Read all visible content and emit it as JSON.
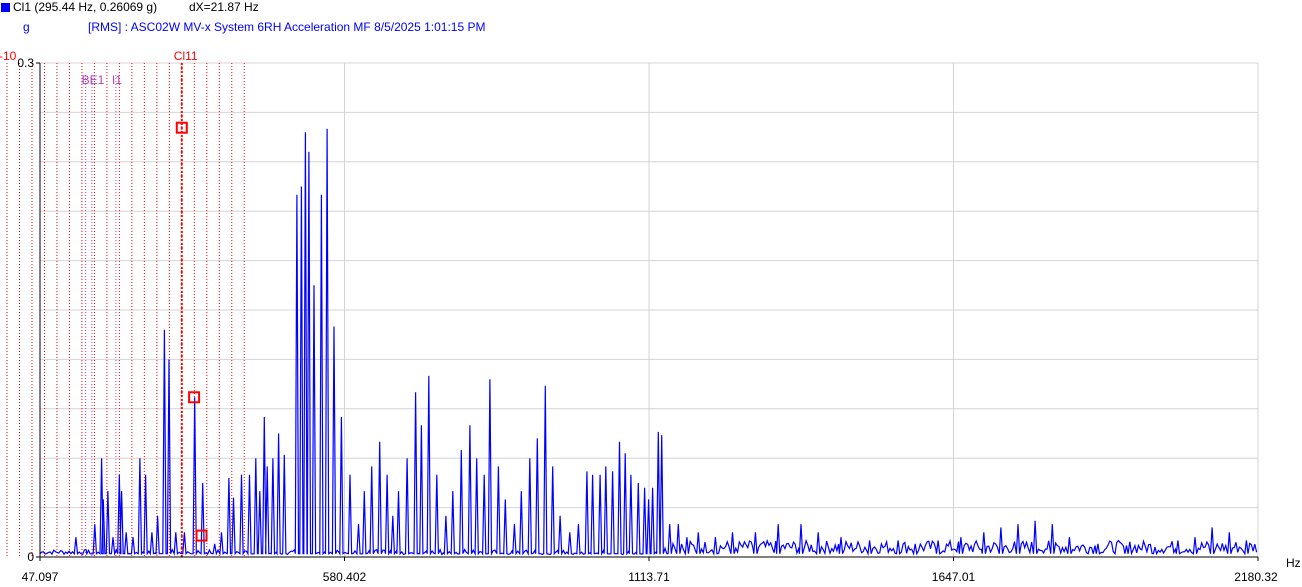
{
  "header": {
    "cursor_readout": "Cl1 (295.44 Hz, 0.26069 g)",
    "delta_readout": "dX=21.87 Hz",
    "y_unit": "g",
    "series_title": "[RMS] : ASC02W MV-x System 6RH Acceleration MF 8/5/2025 1:01:15 PM"
  },
  "colors": {
    "series": "#0000ff",
    "cursor": "#ff0000",
    "band": "#b040c0",
    "grid": "#d4d4d4"
  },
  "chart_data": {
    "type": "line",
    "x_unit": "Hz",
    "y_unit": "g",
    "xlim": [
      47.097,
      2180.32
    ],
    "ylim": [
      0,
      0.3
    ],
    "x_ticks": [
      47.097,
      580.402,
      1113.71,
      1647.01,
      2180.32
    ],
    "x_tick_labels": [
      "47.097",
      "580.402",
      "1113.71",
      "1647.01",
      "2180.32"
    ],
    "y_tick_labels": [
      "0",
      "0.3"
    ],
    "grid": true,
    "series": [
      {
        "peaks": [
          [
            110,
            0.012
          ],
          [
            132,
            0.004
          ],
          [
            143,
            0.02
          ],
          [
            155,
            0.06
          ],
          [
            158,
            0.035
          ],
          [
            166,
            0.04
          ],
          [
            175,
            0.012
          ],
          [
            186,
            0.05
          ],
          [
            190,
            0.04
          ],
          [
            198,
            0.015
          ],
          [
            210,
            0.012
          ],
          [
            222,
            0.06
          ],
          [
            232,
            0.05
          ],
          [
            243,
            0.015
          ],
          [
            253,
            0.025
          ],
          [
            265,
            0.138
          ],
          [
            273,
            0.12
          ],
          [
            285,
            0.015
          ],
          [
            300,
            0.015
          ],
          [
            318,
            0.097
          ],
          [
            332,
            0.045
          ],
          [
            353,
            0.008
          ],
          [
            365,
            0.015
          ],
          [
            378,
            0.048
          ],
          [
            386,
            0.036
          ],
          [
            400,
            0.05
          ],
          [
            414,
            0.05
          ],
          [
            425,
            0.06
          ],
          [
            432,
            0.04
          ],
          [
            440,
            0.085
          ],
          [
            445,
            0.055
          ],
          [
            455,
            0.06
          ],
          [
            465,
            0.075
          ],
          [
            475,
            0.062
          ],
          [
            497,
            0.22
          ],
          [
            505,
            0.225
          ],
          [
            512,
            0.258
          ],
          [
            518,
            0.246
          ],
          [
            527,
            0.165
          ],
          [
            540,
            0.22
          ],
          [
            550,
            0.26
          ],
          [
            562,
            0.14
          ],
          [
            575,
            0.085
          ],
          [
            590,
            0.05
          ],
          [
            605,
            0.02
          ],
          [
            615,
            0.04
          ],
          [
            628,
            0.055
          ],
          [
            642,
            0.07
          ],
          [
            655,
            0.05
          ],
          [
            665,
            0.025
          ],
          [
            675,
            0.04
          ],
          [
            690,
            0.06
          ],
          [
            705,
            0.1
          ],
          [
            715,
            0.08
          ],
          [
            728,
            0.11
          ],
          [
            742,
            0.05
          ],
          [
            758,
            0.025
          ],
          [
            770,
            0.04
          ],
          [
            785,
            0.065
          ],
          [
            800,
            0.08
          ],
          [
            812,
            0.06
          ],
          [
            825,
            0.05
          ],
          [
            835,
            0.108
          ],
          [
            850,
            0.055
          ],
          [
            862,
            0.035
          ],
          [
            878,
            0.02
          ],
          [
            890,
            0.04
          ],
          [
            905,
            0.06
          ],
          [
            918,
            0.072
          ],
          [
            932,
            0.104
          ],
          [
            945,
            0.055
          ],
          [
            958,
            0.025
          ],
          [
            975,
            0.015
          ],
          [
            990,
            0.02
          ],
          [
            1005,
            0.052
          ],
          [
            1015,
            0.05
          ],
          [
            1028,
            0.05
          ],
          [
            1038,
            0.055
          ],
          [
            1050,
            0.052
          ],
          [
            1062,
            0.07
          ],
          [
            1072,
            0.063
          ],
          [
            1082,
            0.05
          ],
          [
            1095,
            0.045
          ],
          [
            1106,
            0.042
          ],
          [
            1113,
            0.035
          ],
          [
            1120,
            0.042
          ],
          [
            1130,
            0.076
          ],
          [
            1136,
            0.074
          ],
          [
            1150,
            0.02
          ],
          [
            1165,
            0.02
          ],
          [
            1180,
            0.012
          ],
          [
            1200,
            0.015
          ],
          [
            1230,
            0.012
          ],
          [
            1260,
            0.015
          ],
          [
            1300,
            0.015
          ],
          [
            1340,
            0.02
          ],
          [
            1380,
            0.02
          ],
          [
            1410,
            0.015
          ],
          [
            1450,
            0.012
          ],
          [
            1500,
            0.01
          ],
          [
            1550,
            0.01
          ],
          [
            1580,
            0.008
          ],
          [
            1620,
            0.01
          ],
          [
            1660,
            0.012
          ],
          [
            1700,
            0.015
          ],
          [
            1730,
            0.018
          ],
          [
            1760,
            0.02
          ],
          [
            1790,
            0.022
          ],
          [
            1820,
            0.02
          ],
          [
            1850,
            0.012
          ],
          [
            1900,
            0.008
          ],
          [
            1950,
            0.007
          ],
          [
            2000,
            0.006
          ],
          [
            2040,
            0.01
          ],
          [
            2070,
            0.012
          ],
          [
            2100,
            0.018
          ],
          [
            2130,
            0.015
          ],
          [
            2160,
            0.01
          ]
        ]
      }
    ],
    "cursor": {
      "label": "Cl11",
      "x": 295.44,
      "markers": [
        [
          295.44,
          0.26069
        ],
        [
          317,
          0.097
        ],
        [
          330,
          0.013
        ]
      ]
    },
    "harmonic_cursors": {
      "start": 208.0,
      "step": 21.87,
      "count": 20,
      "first_label": "-10"
    },
    "band_markers": [
      {
        "label": "BE1",
        "x": 127.0
      },
      {
        "label": "",
        "x": 138.0
      },
      {
        "label": "I1",
        "x": 180.0
      }
    ]
  }
}
